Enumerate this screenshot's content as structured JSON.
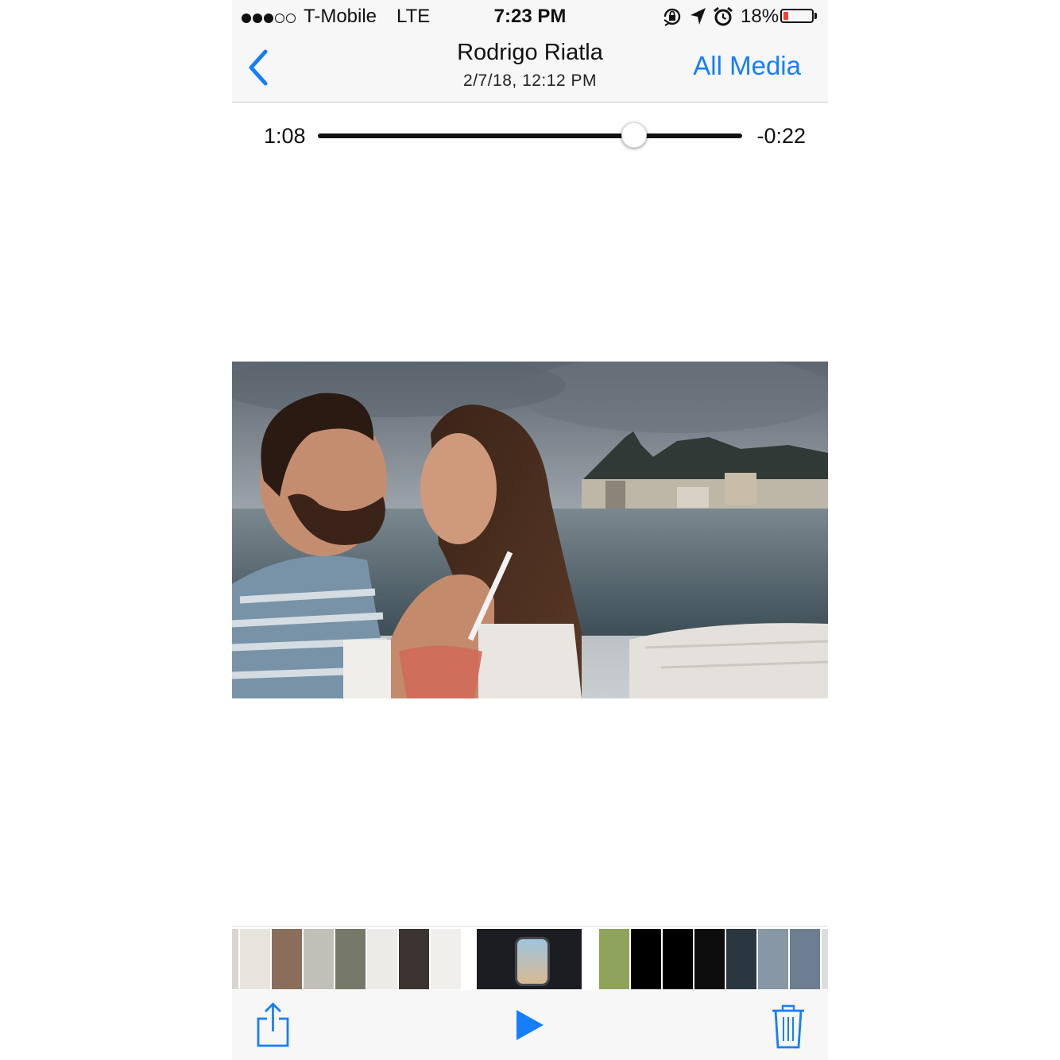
{
  "status_bar": {
    "signal_dots_filled": 3,
    "signal_dots_total": 5,
    "carrier": "T-Mobile",
    "network": "LTE",
    "time": "7:23 PM",
    "icons": [
      "orientation-lock-icon",
      "location-arrow-icon",
      "alarm-icon"
    ],
    "battery_percent": "18%",
    "battery_level": 0.18,
    "battery_color": "#ff3b30"
  },
  "nav": {
    "back_icon": "chevron-left-icon",
    "title": "Rodrigo Riatla",
    "subtitle": "2/7/18, 12:12 PM",
    "right_button": "All Media",
    "accent_color": "#157efb"
  },
  "scrubber": {
    "elapsed": "1:08",
    "remaining": "-0:22",
    "progress": 0.745
  },
  "video": {
    "description_icon": "video-frame"
  },
  "toolbar": {
    "share_icon": "share-icon",
    "play_icon": "play-icon",
    "trash_icon": "trash-icon"
  }
}
